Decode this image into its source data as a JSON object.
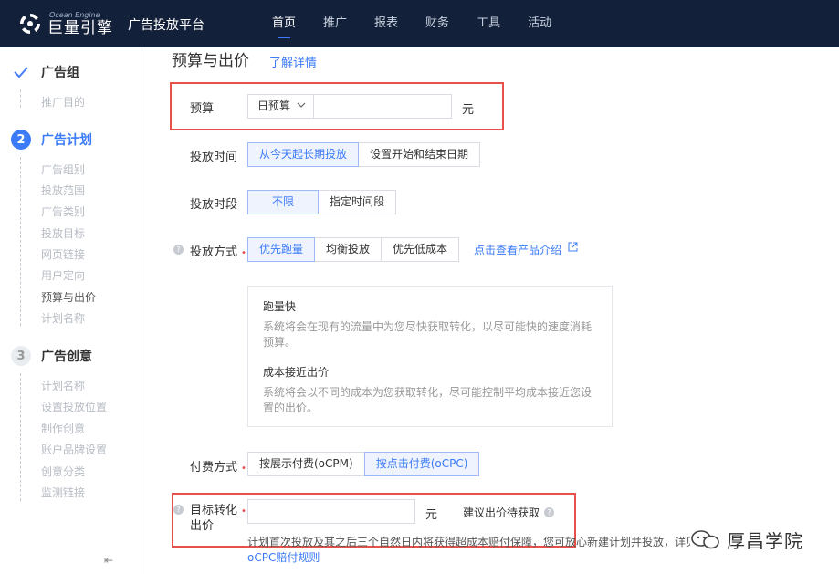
{
  "topbar": {
    "logo_en": "Ocean Engine",
    "logo_cn": "巨量引擎",
    "platform": "广告投放平台",
    "nav": [
      "首页",
      "推广",
      "报表",
      "财务",
      "工具",
      "活动"
    ]
  },
  "sidebar": {
    "step1": {
      "label": "广告组",
      "subs": [
        "推广目的"
      ]
    },
    "step2": {
      "num": "2",
      "label": "广告计划",
      "subs": [
        "广告组别",
        "投放范围",
        "广告类别",
        "投放目标",
        "网页链接",
        "用户定向",
        "预算与出价",
        "计划名称"
      ]
    },
    "step3": {
      "num": "3",
      "label": "广告创意",
      "subs": [
        "计划名称",
        "设置投放位置",
        "制作创意",
        "账户品牌设置",
        "创意分类",
        "监测链接"
      ]
    },
    "collapse": "⇤"
  },
  "main": {
    "title": "预算与出价",
    "learn_more": "了解详情",
    "budget": {
      "label": "预算",
      "select": "日预算",
      "unit": "元"
    },
    "schedule": {
      "label": "投放时间",
      "options": [
        "从今天起长期投放",
        "设置开始和结束日期"
      ]
    },
    "period": {
      "label": "投放时段",
      "options": [
        "不限",
        "指定时间段"
      ]
    },
    "method": {
      "label": "投放方式",
      "options": [
        "优先跑量",
        "均衡投放",
        "优先低成本"
      ],
      "link": "点击查看产品介绍"
    },
    "info": {
      "t1": "跑量快",
      "d1": "系统将会在现有的流量中为您尽快获取转化，以尽可能快的速度消耗预算。",
      "t2": "成本接近出价",
      "d2": "系统将会以不同的成本为您获取转化，尽可能控制平均成本接近您设置的出价。"
    },
    "billing": {
      "label": "付费方式",
      "options": [
        "按展示付费(oCPM)",
        "按点击付费(oCPC)"
      ]
    },
    "target": {
      "label_line1": "目标转化",
      "label_line2": "出价",
      "unit": "元",
      "suggest": "建议出价待获取"
    },
    "note": "计划首次投放及其之后三个自然日内将获得超成本赔付保障，您可放心新建计划并投放，详见",
    "note_link": "oCPC赔付规则"
  },
  "watermark": "厚昌学院",
  "colors": {
    "topbar": "#13203a",
    "accent": "#3b7bf7",
    "highlight": "#e8504a"
  }
}
